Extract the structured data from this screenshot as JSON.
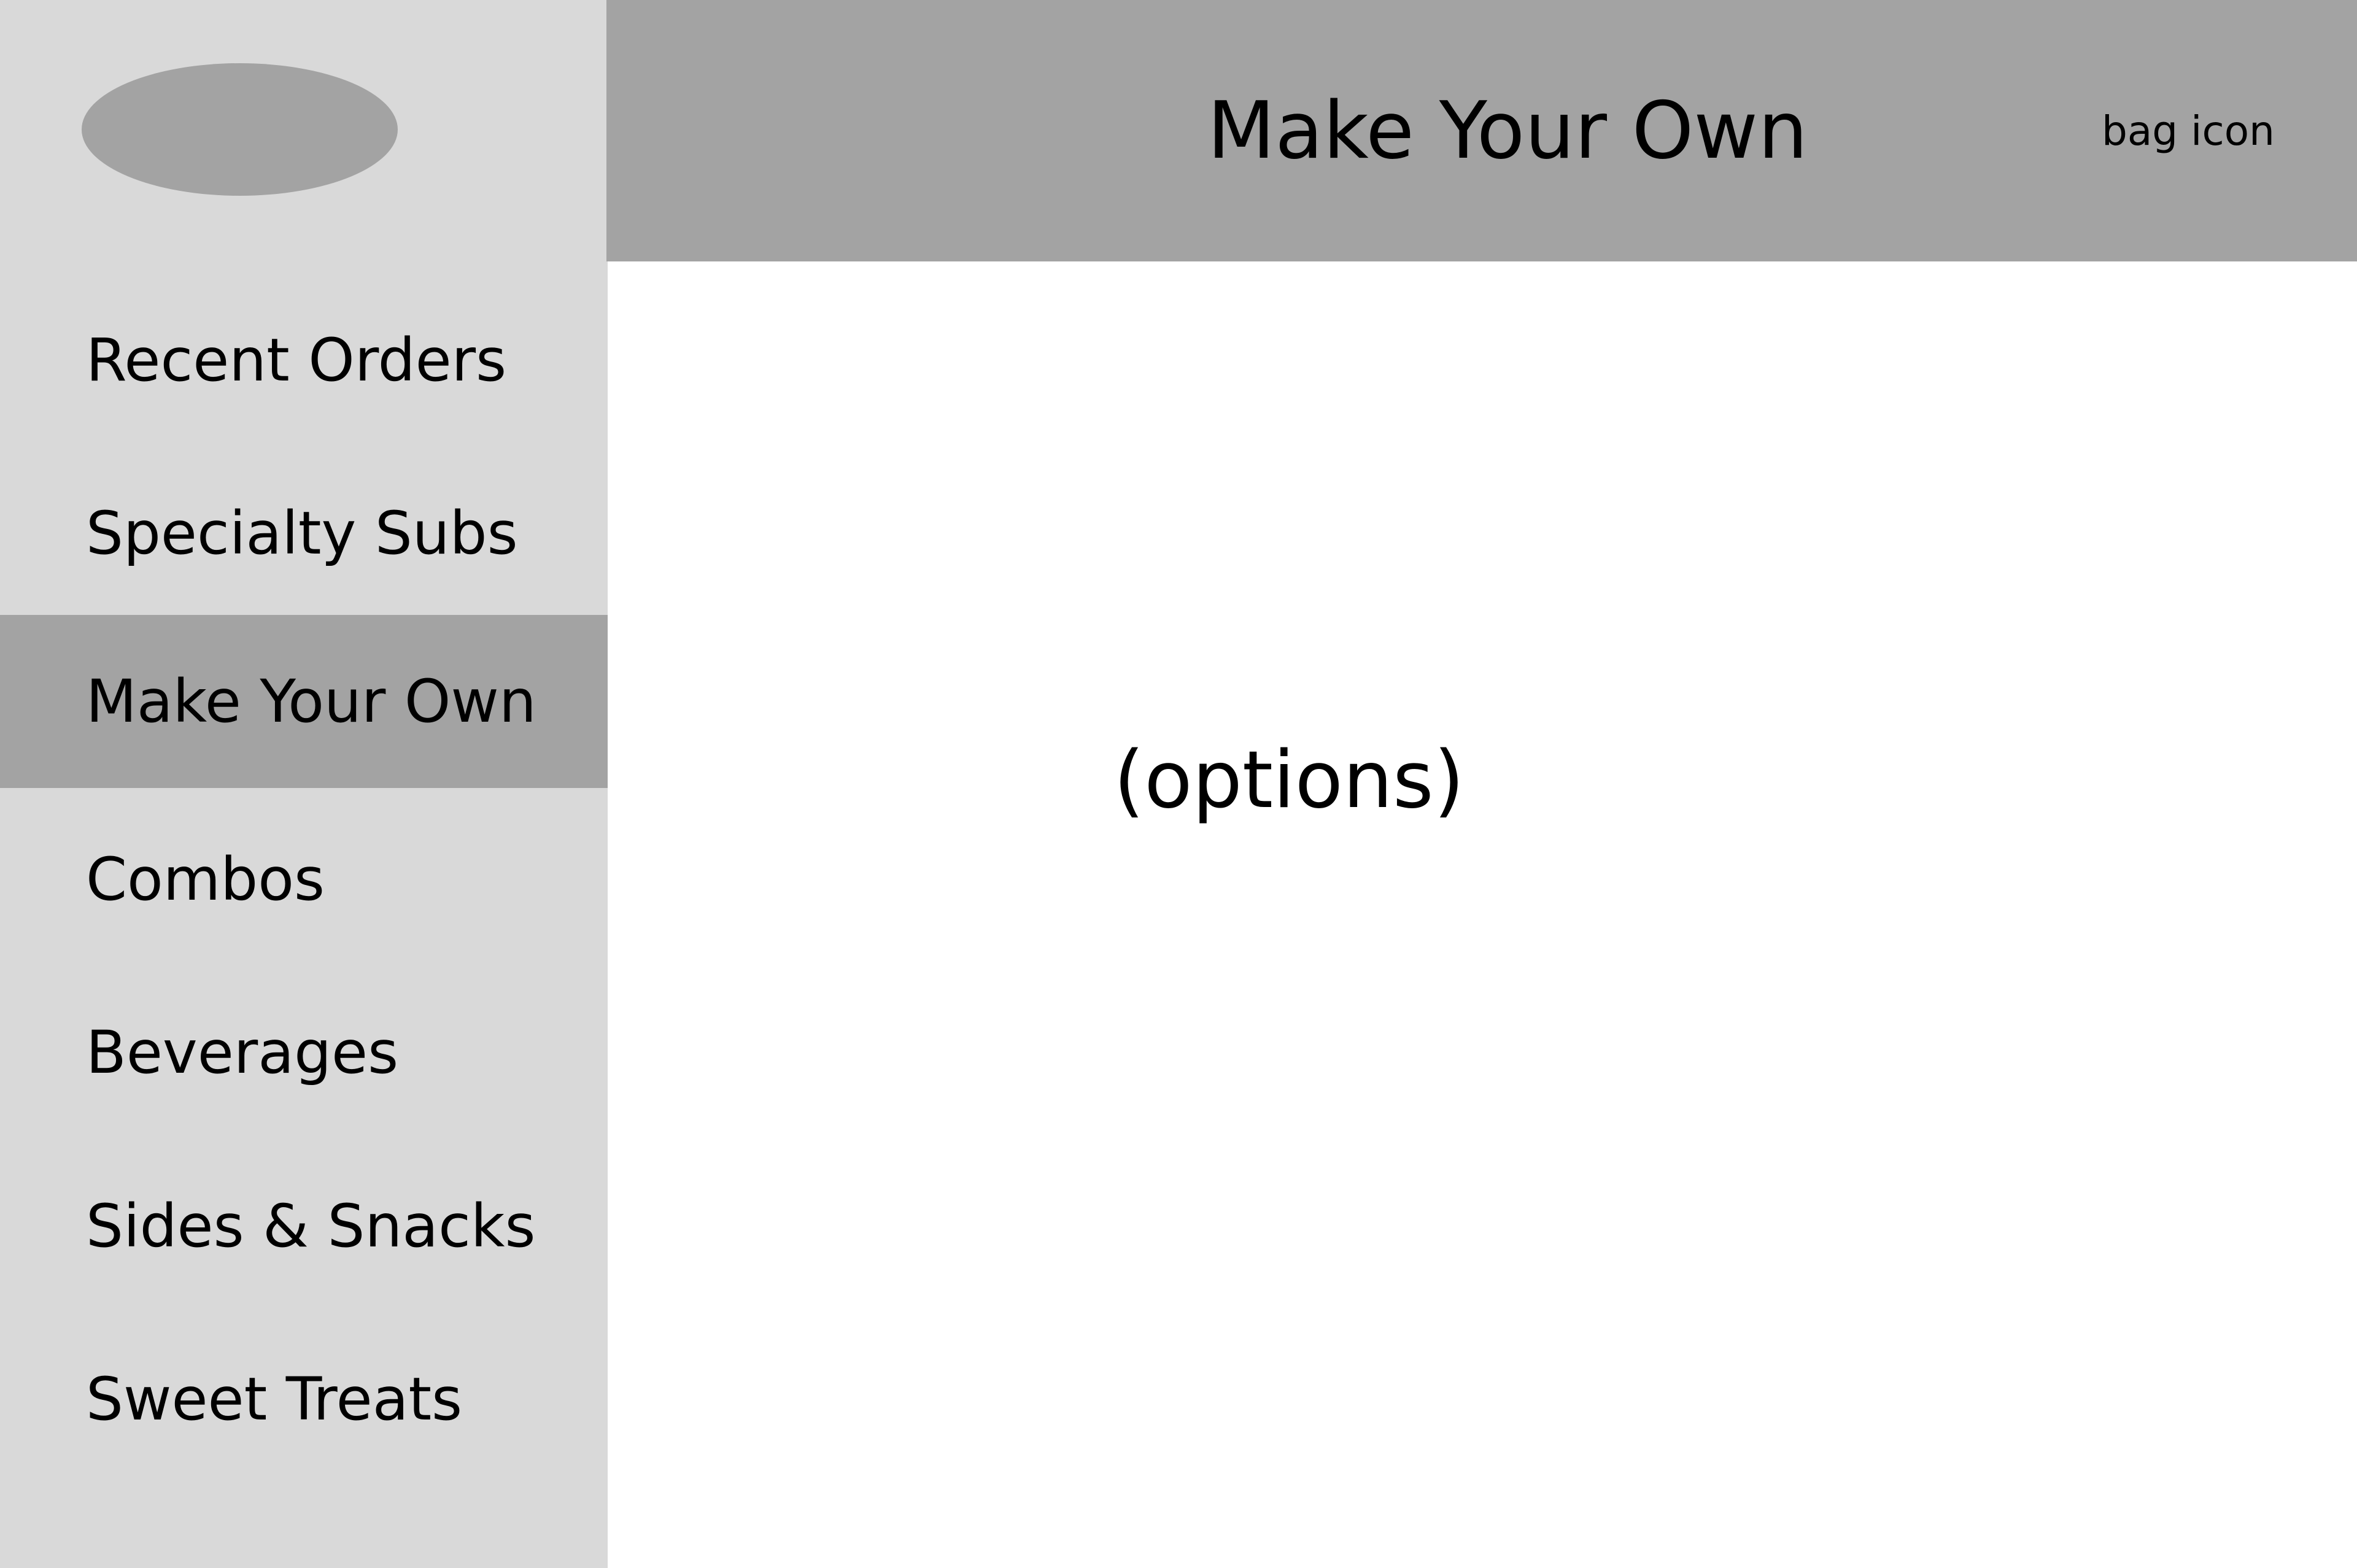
{
  "sidebar": {
    "items": [
      {
        "label": "Recent Orders"
      },
      {
        "label": "Specialty Subs"
      },
      {
        "label": "Make Your Own"
      },
      {
        "label": "Combos"
      },
      {
        "label": "Beverages"
      },
      {
        "label": "Sides & Snacks"
      },
      {
        "label": "Sweet Treats"
      }
    ],
    "active_index": 2
  },
  "header": {
    "title": "Make Your Own",
    "bag_label": "bag icon"
  },
  "main": {
    "placeholder": "(options)"
  },
  "colors": {
    "sidebar_bg": "#d9d9d9",
    "header_bg": "#a3a3a3",
    "active_item_bg": "#a3a3a3",
    "logo_placeholder": "#a3a3a3",
    "content_bg": "#ffffff"
  }
}
